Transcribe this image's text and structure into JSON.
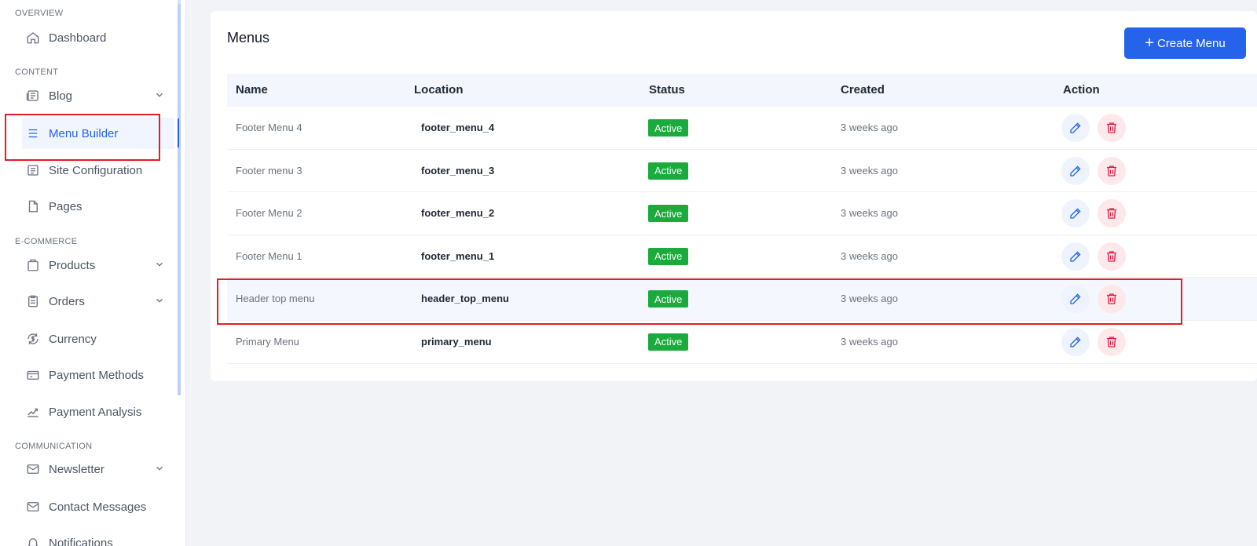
{
  "sidebar": {
    "sections": {
      "overview": "OVERVIEW",
      "content": "CONTENT",
      "ecommerce": "E-COMMERCE",
      "communication": "COMMUNICATION"
    },
    "items": {
      "dashboard": "Dashboard",
      "blog": "Blog",
      "menu_builder": "Menu Builder",
      "site_configuration": "Site Configuration",
      "pages": "Pages",
      "products": "Products",
      "orders": "Orders",
      "currency": "Currency",
      "payment_methods": "Payment Methods",
      "payment_analysis": "Payment Analysis",
      "newsletter": "Newsletter",
      "contact_messages": "Contact Messages",
      "notifications": "Notifications"
    }
  },
  "main": {
    "title": "Menus",
    "create_label": "Create Menu",
    "columns": {
      "name": "Name",
      "location": "Location",
      "status": "Status",
      "created": "Created",
      "action": "Action"
    },
    "rows": [
      {
        "name": "Footer Menu 4",
        "location": "footer_menu_4",
        "status": "Active",
        "created": "3 weeks ago"
      },
      {
        "name": "Footer menu 3",
        "location": "footer_menu_3",
        "status": "Active",
        "created": "3 weeks ago"
      },
      {
        "name": "Footer Menu 2",
        "location": "footer_menu_2",
        "status": "Active",
        "created": "3 weeks ago"
      },
      {
        "name": "Footer Menu 1",
        "location": "footer_menu_1",
        "status": "Active",
        "created": "3 weeks ago"
      },
      {
        "name": "Header top menu",
        "location": "header_top_menu",
        "status": "Active",
        "created": "3 weeks ago"
      },
      {
        "name": "Primary Menu",
        "location": "primary_menu",
        "status": "Active",
        "created": "3 weeks ago"
      }
    ]
  },
  "colors": {
    "accent": "#2563eb",
    "status_active": "#1aab3c",
    "delete": "#e11d48",
    "highlight_box": "#e11d2b"
  }
}
